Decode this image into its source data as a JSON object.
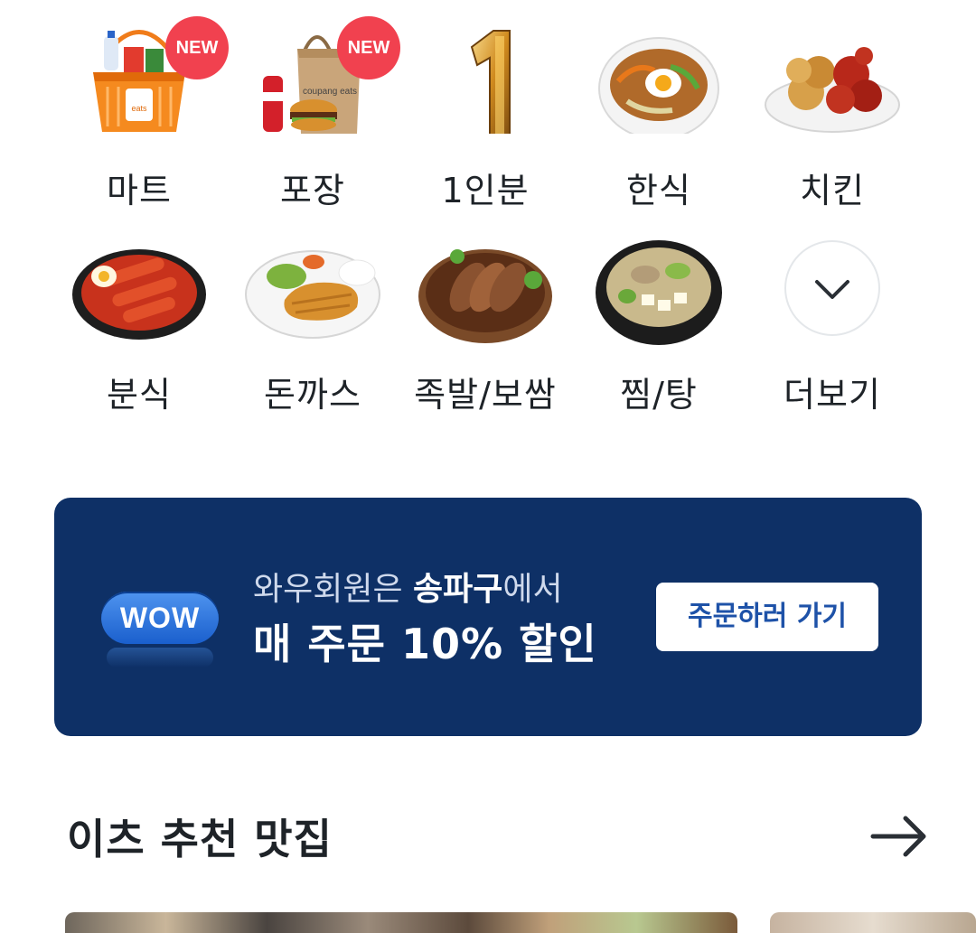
{
  "categories": [
    {
      "label": "마트",
      "icon": "shopping-basket-icon",
      "badge": "NEW"
    },
    {
      "label": "포장",
      "icon": "takeout-bag-icon",
      "badge": "NEW"
    },
    {
      "label": "1인분",
      "icon": "number-one-icon"
    },
    {
      "label": "한식",
      "icon": "bibimbap-icon"
    },
    {
      "label": "치킨",
      "icon": "fried-chicken-icon"
    },
    {
      "label": "분식",
      "icon": "tteokbokki-icon"
    },
    {
      "label": "돈까스",
      "icon": "pork-cutlet-icon"
    },
    {
      "label": "족발/보쌈",
      "icon": "jokbal-icon"
    },
    {
      "label": "찜/탕",
      "icon": "stew-icon"
    },
    {
      "label": "더보기",
      "icon": "chevron-down-icon"
    }
  ],
  "basket_sign": "eats",
  "bag_brand": "coupang eats",
  "banner": {
    "badge": "WOW",
    "line1_prefix": "와우회원은 ",
    "line1_highlight": "송파구",
    "line1_suffix": "에서",
    "line2": "매 주문 10% 할인",
    "button": "주문하러 가기"
  },
  "section": {
    "title": "이츠 추천 맛집",
    "arrow_icon": "arrow-right-icon"
  },
  "colors": {
    "banner_bg": "#0e3066",
    "badge_red": "#f1414f",
    "button_text": "#1e52a8"
  }
}
